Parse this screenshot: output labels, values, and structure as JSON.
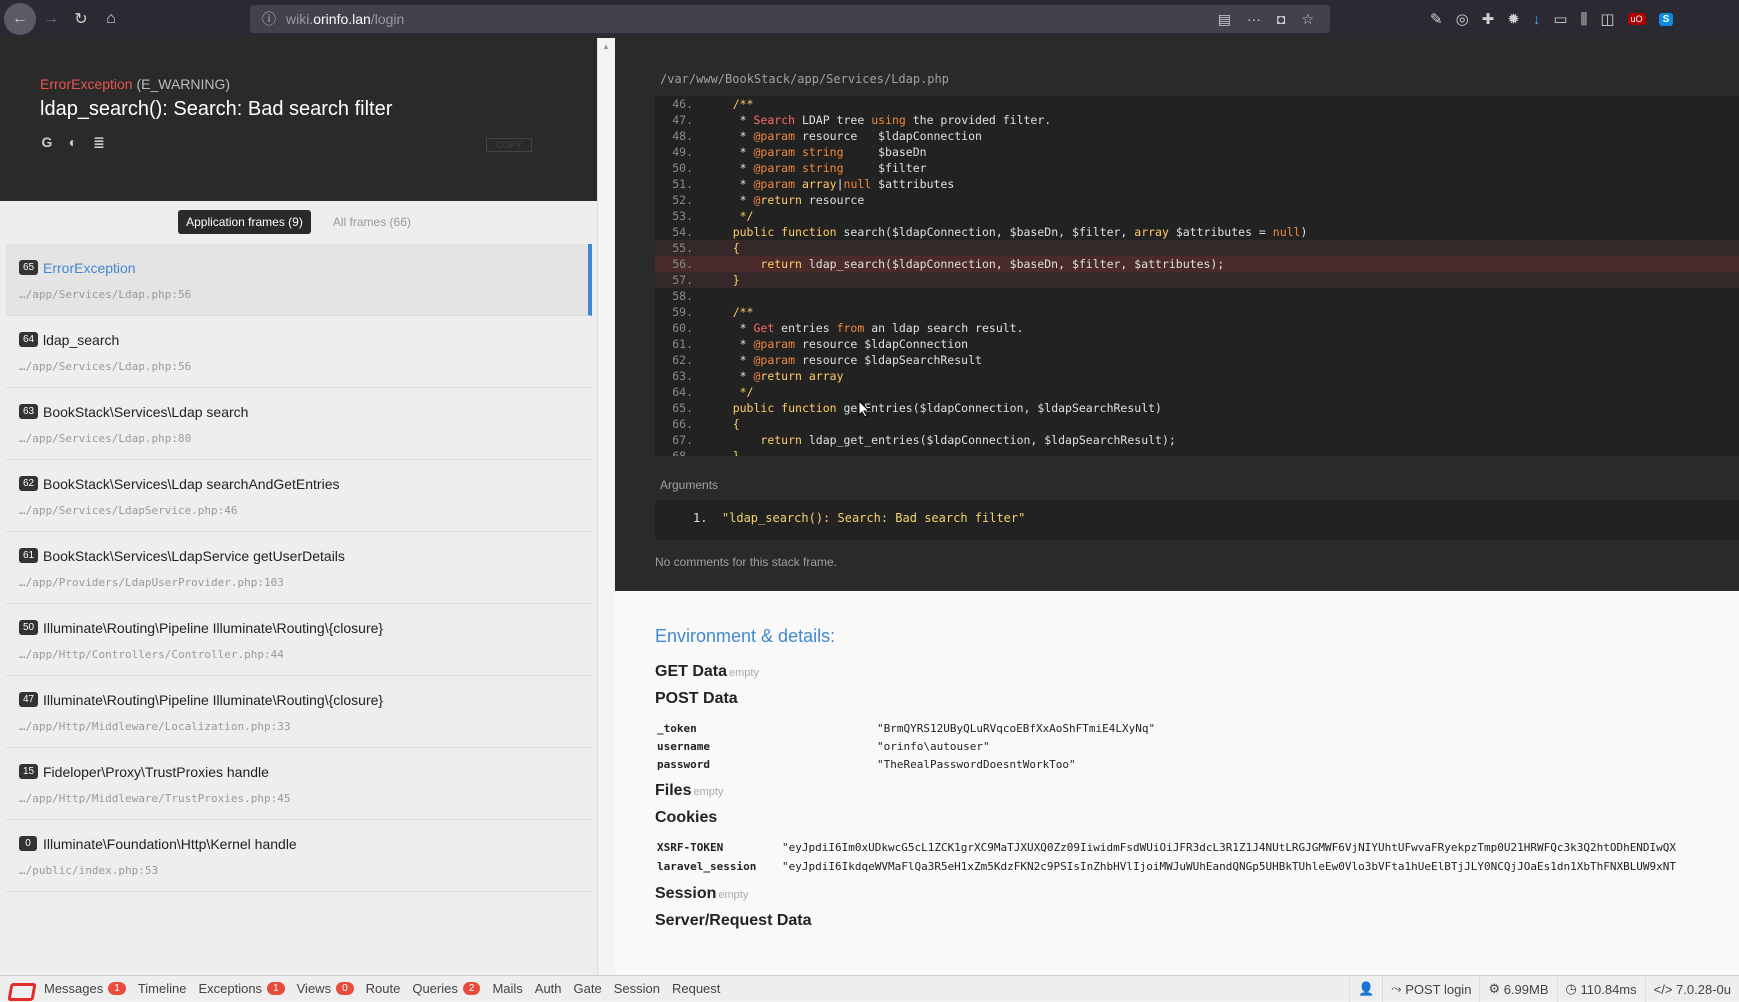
{
  "browser": {
    "host_prefix": "wiki.",
    "host_main": "orinfo.lan",
    "path": "/login"
  },
  "exception": {
    "class": "ErrorException",
    "type": "(E_WARNING)",
    "message": "ldap_search(): Search: Bad search filter",
    "copy_label": "COPY"
  },
  "tabs": {
    "application": "Application frames (9)",
    "all": "All frames (66)"
  },
  "frames": [
    {
      "num": "65",
      "fn": "ErrorException",
      "file": "…/app/Services/Ldap.php:56"
    },
    {
      "num": "64",
      "fn": "ldap_search",
      "file": "…/app/Services/Ldap.php:56"
    },
    {
      "num": "63",
      "fn": "BookStack\\Services\\Ldap search",
      "file": "…/app/Services/Ldap.php:80"
    },
    {
      "num": "62",
      "fn": "BookStack\\Services\\Ldap searchAndGetEntries",
      "file": "…/app/Services/LdapService.php:46"
    },
    {
      "num": "61",
      "fn": "BookStack\\Services\\LdapService getUserDetails",
      "file": "…/app/Providers/LdapUserProvider.php:103"
    },
    {
      "num": "50",
      "fn": "Illuminate\\Routing\\Pipeline Illuminate\\Routing\\{closure}",
      "file": "…/app/Http/Controllers/Controller.php:44"
    },
    {
      "num": "47",
      "fn": "Illuminate\\Routing\\Pipeline Illuminate\\Routing\\{closure}",
      "file": "…/app/Http/Middleware/Localization.php:33"
    },
    {
      "num": "15",
      "fn": "Fideloper\\Proxy\\TrustProxies handle",
      "file": "…/app/Http/Middleware/TrustProxies.php:45"
    },
    {
      "num": "0",
      "fn": "Illuminate\\Foundation\\Http\\Kernel handle",
      "file": "…/public/index.php:53"
    }
  ],
  "code": {
    "path": "/var/www/BookStack/app/Services/Ldap.php",
    "lines": [
      {
        "n": "46.",
        "t": "    /**"
      },
      {
        "n": "47.",
        "t": "     * Search LDAP tree using the provided filter."
      },
      {
        "n": "48.",
        "t": "     * @param resource   $ldapConnection"
      },
      {
        "n": "49.",
        "t": "     * @param string     $baseDn"
      },
      {
        "n": "50.",
        "t": "     * @param string     $filter"
      },
      {
        "n": "51.",
        "t": "     * @param array|null $attributes"
      },
      {
        "n": "52.",
        "t": "     * @return resource"
      },
      {
        "n": "53.",
        "t": "     */"
      },
      {
        "n": "54.",
        "t": "    public function search($ldapConnection, $baseDn, $filter, array $attributes = null)"
      },
      {
        "n": "55.",
        "t": "    {"
      },
      {
        "n": "56.",
        "t": "        return ldap_search($ldapConnection, $baseDn, $filter, $attributes);"
      },
      {
        "n": "57.",
        "t": "    }"
      },
      {
        "n": "58.",
        "t": ""
      },
      {
        "n": "59.",
        "t": "    /**"
      },
      {
        "n": "60.",
        "t": "     * Get entries from an ldap search result."
      },
      {
        "n": "61.",
        "t": "     * @param resource $ldapConnection"
      },
      {
        "n": "62.",
        "t": "     * @param resource $ldapSearchResult"
      },
      {
        "n": "63.",
        "t": "     * @return array"
      },
      {
        "n": "64.",
        "t": "     */"
      },
      {
        "n": "65.",
        "t": "    public function getEntries($ldapConnection, $ldapSearchResult)"
      },
      {
        "n": "66.",
        "t": "    {"
      },
      {
        "n": "67.",
        "t": "        return ldap_get_entries($ldapConnection, $ldapSearchResult);"
      },
      {
        "n": "68.",
        "t": "    }"
      }
    ],
    "highlight_line": "56."
  },
  "arguments": {
    "title": "Arguments",
    "items": [
      "\"ldap_search(): Search: Bad search filter\""
    ]
  },
  "no_comments": "No comments for this stack frame.",
  "env": {
    "title": "Environment & details:",
    "get_label": "GET Data",
    "post_label": "POST Data",
    "files_label": "Files",
    "cookies_label": "Cookies",
    "session_label": "Session",
    "server_label": "Server/Request Data",
    "empty": "empty",
    "post": [
      {
        "k": "_token",
        "v": "\"BrmQYRS12UByQLuRVqcoEBfXxAoShFTmiE4LXyNq\""
      },
      {
        "k": "username",
        "v": "\"orinfo\\autouser\""
      },
      {
        "k": "password",
        "v": "\"TheRealPasswordDoesntWorkToo\""
      }
    ],
    "cookies": [
      {
        "k": "XSRF-TOKEN",
        "v": "\"eyJpdiI6Im0xUDkwcG5cL1ZCK1grXC9MaTJXUXQ0Zz09IiwidmFsdWUiOiJFR3dcL3R1Z1J4NUtLRGJGMWF6VjNIYUhtUFwvaFRyekpzTmp0U21HRWFQc3k3Q2htODhENDIwQX"
      },
      {
        "k": "laravel_session",
        "v": "\"eyJpdiI6IkdqeWVMaFlQa3R5eH1xZm5KdzFKN2c9PSIsInZhbHVlIjoiMWJuWUhEandQNGp5UHBkTUhleEw0Vlo3bVFta1hUeElBTjJLY0NCQjJOaEs1dn1XbThFNXBLUW9xNT"
      }
    ]
  },
  "debugbar": {
    "items": [
      {
        "label": "Messages",
        "badge": "1"
      },
      {
        "label": "Timeline",
        "badge": ""
      },
      {
        "label": "Exceptions",
        "badge": "1"
      },
      {
        "label": "Views",
        "badge": "0"
      },
      {
        "label": "Route",
        "badge": ""
      },
      {
        "label": "Queries",
        "badge": "2"
      },
      {
        "label": "Mails",
        "badge": ""
      },
      {
        "label": "Auth",
        "badge": ""
      },
      {
        "label": "Gate",
        "badge": ""
      },
      {
        "label": "Session",
        "badge": ""
      },
      {
        "label": "Request",
        "badge": ""
      }
    ],
    "route": "POST login",
    "memory": "6.99MB",
    "time": "110.84ms",
    "php": "7.0.28-0u"
  },
  "colors": {
    "accent": "#4288ce",
    "error": "#e95353",
    "badge": "#e74c3c"
  }
}
